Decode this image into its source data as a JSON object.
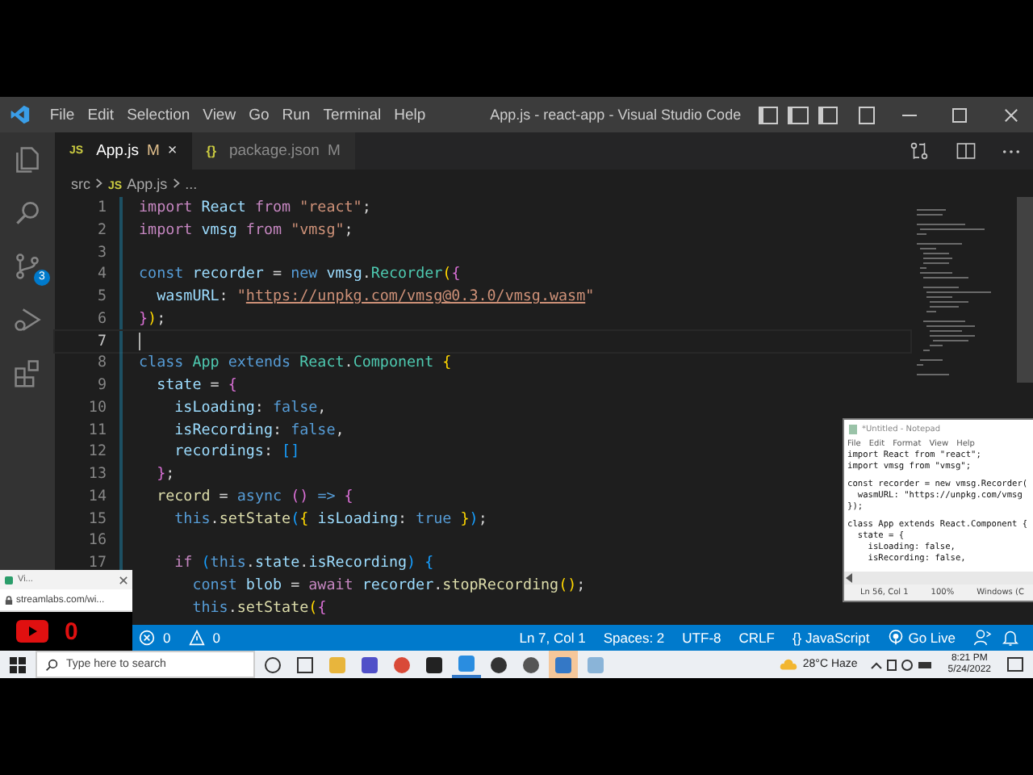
{
  "menu": [
    "File",
    "Edit",
    "Selection",
    "View",
    "Go",
    "Run",
    "Terminal",
    "Help"
  ],
  "window": {
    "title": "App.js - react-app - Visual Studio Code"
  },
  "tabs": [
    {
      "icon": "JS",
      "label": "App.js",
      "badge": "M",
      "close": "×",
      "selected": true
    },
    {
      "icon": "{}",
      "label": "package.json",
      "badge": "M",
      "selected": false
    }
  ],
  "breadcrumb": [
    {
      "label": "src"
    },
    {
      "icon": "JS",
      "label": "App.js"
    },
    {
      "label": "..."
    }
  ],
  "activity_bar": {
    "source_control_badge": "3"
  },
  "lines": [
    {
      "n": "1",
      "current": false,
      "tokens": [
        {
          "text": "import ",
          "kind": "ctl"
        },
        {
          "text": "React ",
          "kind": "var"
        },
        {
          "text": "from ",
          "kind": "ctl"
        },
        {
          "text": "\"react\"",
          "kind": "str"
        },
        {
          "text": ";",
          "kind": "p"
        }
      ]
    },
    {
      "n": "2",
      "current": false,
      "tokens": [
        {
          "text": "import ",
          "kind": "ctl"
        },
        {
          "text": "vmsg ",
          "kind": "var"
        },
        {
          "text": "from ",
          "kind": "ctl"
        },
        {
          "text": "\"vmsg\"",
          "kind": "str"
        },
        {
          "text": ";",
          "kind": "p"
        }
      ]
    },
    {
      "n": "3",
      "current": false
    },
    {
      "n": "4",
      "current": false,
      "tokens": [
        {
          "text": "const ",
          "kind": "kw"
        },
        {
          "text": "recorder ",
          "kind": "var"
        },
        {
          "text": "= ",
          "kind": "p"
        },
        {
          "text": "new ",
          "kind": "kw"
        },
        {
          "text": "vmsg",
          "kind": "var"
        },
        {
          "text": ".",
          "kind": "p"
        },
        {
          "text": "Recorder",
          "kind": "cls"
        },
        {
          "text": "(",
          "kind": "b1"
        },
        {
          "text": "{",
          "kind": "b2"
        }
      ]
    },
    {
      "n": "5",
      "current": false,
      "tokens": [
        {
          "text": "  wasmURL",
          "kind": "var"
        },
        {
          "text": ": ",
          "kind": "p"
        },
        {
          "text": "\"",
          "kind": "str"
        },
        {
          "text": "https://unpkg.com/vmsg@0.3.0/vmsg.wasm",
          "kind": "url"
        },
        {
          "text": "\"",
          "kind": "str"
        }
      ]
    },
    {
      "n": "6",
      "current": false,
      "tokens": [
        {
          "text": "}",
          "kind": "b2"
        },
        {
          "text": ")",
          "kind": "b1"
        },
        {
          "text": ";",
          "kind": "p"
        }
      ]
    },
    {
      "n": "7",
      "current": true
    },
    {
      "n": "8",
      "current": false,
      "tokens": [
        {
          "text": "class ",
          "kind": "kw"
        },
        {
          "text": "App ",
          "kind": "cls"
        },
        {
          "text": "extends ",
          "kind": "kw"
        },
        {
          "text": "React",
          "kind": "cls"
        },
        {
          "text": ".",
          "kind": "p"
        },
        {
          "text": "Component ",
          "kind": "cls"
        },
        {
          "text": "{",
          "kind": "b1"
        }
      ]
    },
    {
      "n": "9",
      "current": false,
      "tokens": [
        {
          "text": "  state ",
          "kind": "var"
        },
        {
          "text": "= ",
          "kind": "p"
        },
        {
          "text": "{",
          "kind": "b2"
        }
      ]
    },
    {
      "n": "10",
      "current": false,
      "tokens": [
        {
          "text": "    isLoading",
          "kind": "var"
        },
        {
          "text": ": ",
          "kind": "p"
        },
        {
          "text": "false",
          "kind": "kw"
        },
        {
          "text": ",",
          "kind": "p"
        }
      ]
    },
    {
      "n": "11",
      "current": false,
      "tokens": [
        {
          "text": "    isRecording",
          "kind": "var"
        },
        {
          "text": ": ",
          "kind": "p"
        },
        {
          "text": "false",
          "kind": "kw"
        },
        {
          "text": ",",
          "kind": "p"
        }
      ]
    },
    {
      "n": "12",
      "current": false,
      "tokens": [
        {
          "text": "    recordings",
          "kind": "var"
        },
        {
          "text": ": ",
          "kind": "p"
        },
        {
          "text": "[]",
          "kind": "b3"
        }
      ]
    },
    {
      "n": "13",
      "current": false,
      "tokens": [
        {
          "text": "  }",
          "kind": "b2"
        },
        {
          "text": ";",
          "kind": "p"
        }
      ]
    },
    {
      "n": "14",
      "current": false,
      "tokens": [
        {
          "text": "  record ",
          "kind": "fn"
        },
        {
          "text": "= ",
          "kind": "p"
        },
        {
          "text": "async ",
          "kind": "kw"
        },
        {
          "text": "()",
          "kind": "b2"
        },
        {
          "text": " => ",
          "kind": "kw"
        },
        {
          "text": "{",
          "kind": "b2"
        }
      ]
    },
    {
      "n": "15",
      "current": false,
      "tokens": [
        {
          "text": "    this",
          "kind": "kw"
        },
        {
          "text": ".",
          "kind": "p"
        },
        {
          "text": "setState",
          "kind": "fn"
        },
        {
          "text": "(",
          "kind": "b3"
        },
        {
          "text": "{ ",
          "kind": "b1"
        },
        {
          "text": "isLoading",
          "kind": "var"
        },
        {
          "text": ": ",
          "kind": "p"
        },
        {
          "text": "true ",
          "kind": "kw"
        },
        {
          "text": "}",
          "kind": "b1"
        },
        {
          "text": ")",
          "kind": "b3"
        },
        {
          "text": ";",
          "kind": "p"
        }
      ]
    },
    {
      "n": "16",
      "current": false
    },
    {
      "n": "17",
      "current": false,
      "tokens": [
        {
          "text": "    if ",
          "kind": "ctl"
        },
        {
          "text": "(",
          "kind": "b3"
        },
        {
          "text": "this",
          "kind": "kw"
        },
        {
          "text": ".",
          "kind": "p"
        },
        {
          "text": "state",
          "kind": "var"
        },
        {
          "text": ".",
          "kind": "p"
        },
        {
          "text": "isRecording",
          "kind": "var"
        },
        {
          "text": ") ",
          "kind": "b3"
        },
        {
          "text": "{",
          "kind": "b3"
        }
      ]
    },
    {
      "current": false,
      "tokens": [
        {
          "text": "      const ",
          "kind": "kw"
        },
        {
          "text": "blob ",
          "kind": "var"
        },
        {
          "text": "= ",
          "kind": "p"
        },
        {
          "text": "await ",
          "kind": "ctl"
        },
        {
          "text": "recorder",
          "kind": "var"
        },
        {
          "text": ".",
          "kind": "p"
        },
        {
          "text": "stopRecording",
          "kind": "fn"
        },
        {
          "text": "()",
          "kind": "b1"
        },
        {
          "text": ";",
          "kind": "p"
        }
      ]
    },
    {
      "current": false,
      "tokens": [
        {
          "text": "      this",
          "kind": "kw"
        },
        {
          "text": ".",
          "kind": "p"
        },
        {
          "text": "setState",
          "kind": "fn"
        },
        {
          "text": "(",
          "kind": "b1"
        },
        {
          "text": "{",
          "kind": "b2"
        }
      ]
    }
  ],
  "status_bar": {
    "errors": "0",
    "warnings": "0",
    "items": [
      "Ln 7, Col 1",
      "Spaces: 2",
      "UTF-8",
      "CRLF"
    ],
    "language_icon": "{}",
    "language": "JavaScript",
    "go_live": "Go Live"
  },
  "taskbar": {
    "search_placeholder": "Type here to search",
    "weather": "28°C  Haze",
    "time": "8:21 PM",
    "date": "5/24/2022"
  },
  "notepad": {
    "title": "*Untitled - Notepad",
    "menu": [
      "File",
      "Edit",
      "Format",
      "View",
      "Help"
    ],
    "blocks": [
      [
        "import React from \"react\";",
        "import vmsg from \"vmsg\";"
      ],
      [
        "const recorder = new vmsg.Recorder(",
        "  wasmURL: \"https://unpkg.com/vmsg",
        "});"
      ],
      [
        "class App extends React.Component {",
        "  state = {",
        "    isLoading: false,",
        "    isRecording: false,"
      ]
    ],
    "status": [
      "Ln 56, Col 1",
      "100%",
      "Windows (C"
    ]
  },
  "browser_widget": {
    "tab": "Vi...",
    "url": "streamlabs.com/wi...",
    "count": "0"
  }
}
